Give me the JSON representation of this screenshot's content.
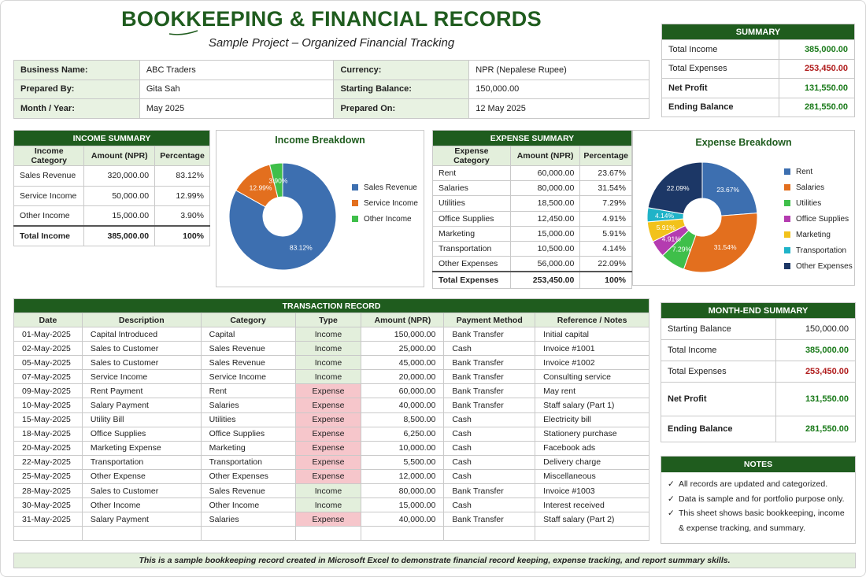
{
  "header": {
    "title": "BOOKKEEPING & FINANCIAL RECORDS",
    "subtitle": "Sample Project – Organized Financial Tracking"
  },
  "info": [
    {
      "l1": "Business Name:",
      "v1": "ABC Traders",
      "l2": "Currency:",
      "v2": "NPR (Nepalese Rupee)"
    },
    {
      "l1": "Prepared By:",
      "v1": "Gita Sah",
      "l2": "Starting Balance:",
      "v2": "150,000.00"
    },
    {
      "l1": "Month / Year:",
      "v1": "May 2025",
      "l2": "Prepared On:",
      "v2": "12 May 2025"
    }
  ],
  "summary": {
    "title": "SUMMARY",
    "rows": [
      {
        "label": "Total Income",
        "value": "385,000.00"
      },
      {
        "label": "Total Expenses",
        "value": "253,450.00"
      },
      {
        "label": "Net Profit",
        "value": "131,550.00"
      },
      {
        "label": "Ending Balance",
        "value": "281,550.00"
      }
    ]
  },
  "income_summary": {
    "title": "INCOME SUMMARY",
    "headers": [
      "Income Category",
      "Amount (NPR)",
      "Percentage"
    ],
    "rows": [
      [
        "Sales Revenue",
        "320,000.00",
        "83.12%"
      ],
      [
        "Service Income",
        "50,000.00",
        "12.99%"
      ],
      [
        "Other Income",
        "15,000.00",
        "3.90%"
      ]
    ],
    "total": [
      "Total Income",
      "385,000.00",
      "100%"
    ]
  },
  "expense_summary": {
    "title": "EXPENSE SUMMARY",
    "headers": [
      "Expense Category",
      "Amount (NPR)",
      "Percentage"
    ],
    "rows": [
      [
        "Rent",
        "60,000.00",
        "23.67%"
      ],
      [
        "Salaries",
        "80,000.00",
        "31.54%"
      ],
      [
        "Utilities",
        "18,500.00",
        "7.29%"
      ],
      [
        "Office Supplies",
        "12,450.00",
        "4.91%"
      ],
      [
        "Marketing",
        "15,000.00",
        "5.91%"
      ],
      [
        "Transportation",
        "10,500.00",
        "4.14%"
      ],
      [
        "Other Expenses",
        "56,000.00",
        "22.09%"
      ]
    ],
    "total": [
      "Total Expenses",
      "253,450.00",
      "100%"
    ]
  },
  "chart_data": [
    {
      "type": "pie",
      "title": "Income Breakdown",
      "categories": [
        "Sales Revenue",
        "Service Income",
        "Other Income"
      ],
      "values": [
        83.12,
        12.99,
        3.9
      ],
      "labels": [
        "83.12%",
        "12.99%",
        "3.90%"
      ],
      "colors": [
        "#3d6fb0",
        "#e36f1e",
        "#3fbf4a"
      ],
      "legend": "right"
    },
    {
      "type": "pie",
      "title": "Expense Breakdown",
      "categories": [
        "Rent",
        "Salaries",
        "Utilities",
        "Office Supplies",
        "Marketing",
        "Transportation",
        "Other Expenses"
      ],
      "values": [
        23.67,
        31.54,
        7.29,
        4.91,
        5.91,
        4.14,
        22.09
      ],
      "labels": [
        "23.67%",
        "31.54%",
        "7.29%",
        "4.91%",
        "5.91%",
        "4.14%",
        "22.09%"
      ],
      "colors": [
        "#3d6fb0",
        "#e36f1e",
        "#3fbf4a",
        "#b43cb0",
        "#f2c21b",
        "#1fb3c8",
        "#1c3766"
      ],
      "legend": "right"
    }
  ],
  "transactions": {
    "title": "TRANSACTION RECORD",
    "headers": [
      "Date",
      "Description",
      "Category",
      "Type",
      "Amount (NPR)",
      "Payment Method",
      "Reference / Notes"
    ],
    "rows": [
      [
        "01-May-2025",
        "Capital Introduced",
        "Capital",
        "Income",
        "150,000.00",
        "Bank Transfer",
        "Initial capital"
      ],
      [
        "02-May-2025",
        "Sales to Customer",
        "Sales Revenue",
        "Income",
        "25,000.00",
        "Cash",
        "Invoice #1001"
      ],
      [
        "05-May-2025",
        "Sales to Customer",
        "Sales Revenue",
        "Income",
        "45,000.00",
        "Bank Transfer",
        "Invoice #1002"
      ],
      [
        "07-May-2025",
        "Service Income",
        "Service Income",
        "Income",
        "20,000.00",
        "Bank Transfer",
        "Consulting service"
      ],
      [
        "09-May-2025",
        "Rent Payment",
        "Rent",
        "Expense",
        "60,000.00",
        "Bank Transfer",
        "May rent"
      ],
      [
        "10-May-2025",
        "Salary Payment",
        "Salaries",
        "Expense",
        "40,000.00",
        "Bank Transfer",
        "Staff salary (Part 1)"
      ],
      [
        "15-May-2025",
        "Utility Bill",
        "Utilities",
        "Expense",
        "8,500.00",
        "Cash",
        "Electricity bill"
      ],
      [
        "18-May-2025",
        "Office Supplies",
        "Office Supplies",
        "Expense",
        "6,250.00",
        "Cash",
        "Stationery purchase"
      ],
      [
        "20-May-2025",
        "Marketing Expense",
        "Marketing",
        "Expense",
        "10,000.00",
        "Cash",
        "Facebook ads"
      ],
      [
        "22-May-2025",
        "Transportation",
        "Transportation",
        "Expense",
        "5,500.00",
        "Cash",
        "Delivery charge"
      ],
      [
        "25-May-2025",
        "Other Expense",
        "Other Expenses",
        "Expense",
        "12,000.00",
        "Cash",
        "Miscellaneous"
      ],
      [
        "28-May-2025",
        "Sales to Customer",
        "Sales Revenue",
        "Income",
        "80,000.00",
        "Bank Transfer",
        "Invoice #1003"
      ],
      [
        "30-May-2025",
        "Other Income",
        "Other Income",
        "Income",
        "15,000.00",
        "Cash",
        "Interest received"
      ],
      [
        "31-May-2025",
        "Salary Payment",
        "Salaries",
        "Expense",
        "40,000.00",
        "Bank Transfer",
        "Staff salary (Part 2)"
      ]
    ]
  },
  "month_end": {
    "title": "MONTH-END SUMMARY",
    "rows": [
      {
        "label": "Starting Balance",
        "value": "150,000.00"
      },
      {
        "label": "Total Income",
        "value": "385,000.00"
      },
      {
        "label": "Total Expenses",
        "value": "253,450.00"
      },
      {
        "label": "Net Profit",
        "value": "131,550.00"
      },
      {
        "label": "Ending Balance",
        "value": "281,550.00"
      }
    ]
  },
  "notes": {
    "title": "NOTES",
    "items": [
      "All records are updated and categorized.",
      "Data is sample and for portfolio purpose only.",
      "This sheet shows basic bookkeeping, income & expense tracking, and summary."
    ]
  },
  "footer": "This is a sample bookkeeping record created in Microsoft Excel to demonstrate financial record keeping, expense tracking, and report summary skills."
}
